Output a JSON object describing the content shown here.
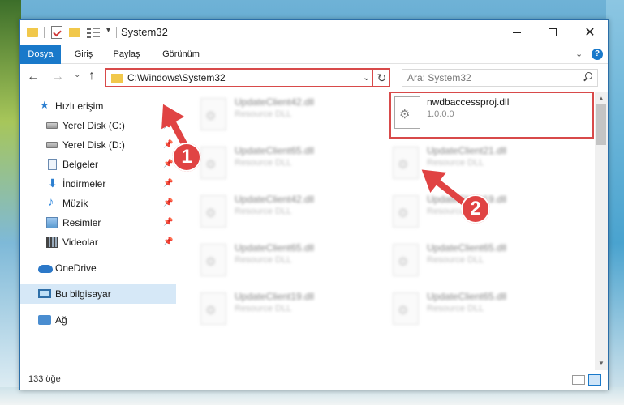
{
  "window": {
    "title": "System32",
    "qa_chevron": "▾"
  },
  "ribbon": {
    "tabs": [
      {
        "label": "Dosya"
      },
      {
        "label": "Giriş"
      },
      {
        "label": "Paylaş"
      },
      {
        "label": "Görünüm"
      }
    ],
    "help": "?"
  },
  "address": {
    "path": "C:\\Windows\\System32",
    "search_placeholder": "Ara: System32"
  },
  "sidebar": {
    "items": [
      {
        "label": "Hızlı erişim"
      },
      {
        "label": "Yerel Disk (C:)"
      },
      {
        "label": "Yerel Disk (D:)"
      },
      {
        "label": "Belgeler"
      },
      {
        "label": "İndirmeler"
      },
      {
        "label": "Müzik"
      },
      {
        "label": "Resimler"
      },
      {
        "label": "Videolar"
      },
      {
        "label": "OneDrive"
      },
      {
        "label": "Bu bilgisayar"
      },
      {
        "label": "Ağ"
      }
    ]
  },
  "files": {
    "left": [
      {
        "name": "UpdateClient42.dll",
        "desc": "Resource DLL"
      },
      {
        "name": "UpdateClient65.dll",
        "desc": "Resource DLL"
      },
      {
        "name": "UpdateClient42.dll",
        "desc": "Resource DLL"
      },
      {
        "name": "UpdateClient65.dll",
        "desc": "Resource DLL"
      },
      {
        "name": "UpdateClient19.dll",
        "desc": "Resource DLL"
      }
    ],
    "highlighted": {
      "name": "nwdbaccessproj.dll",
      "version": "1.0.0.0"
    },
    "right": [
      {
        "name": "UpdateClient21.dll",
        "desc": "Resource DLL"
      },
      {
        "name": "UpdateClient19.dll",
        "desc": "Resource DLL"
      },
      {
        "name": "UpdateClient65.dll",
        "desc": "Resource DLL"
      },
      {
        "name": "UpdateClient65.dll",
        "desc": "Resource DLL"
      }
    ]
  },
  "status": {
    "count": "133 öğe"
  },
  "annotations": {
    "badge1": "1",
    "badge2": "2",
    "color": "#e04343"
  }
}
